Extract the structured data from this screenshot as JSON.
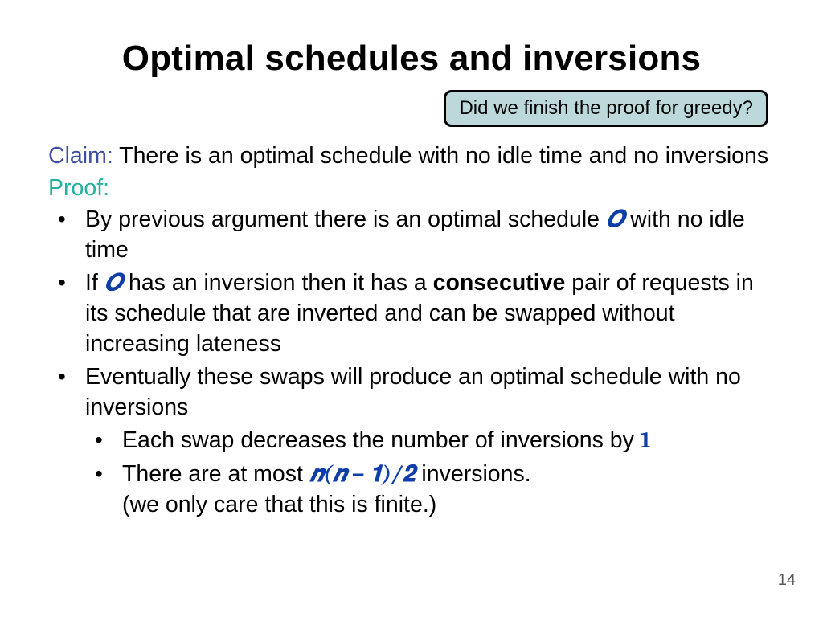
{
  "title": "Optimal schedules and inversions",
  "callout": "Did we finish the proof for greedy?",
  "claim": {
    "label": "Claim:",
    "text": " There is an optimal schedule with no idle time and no inversions"
  },
  "proof": {
    "label": "Proof:"
  },
  "symbols": {
    "O1": "𝑶",
    "O2": "𝑶",
    "one": "1",
    "formula": "𝒏(𝒏 − 𝟏)/𝟐"
  },
  "bullets": {
    "b1a": "By previous argument there is an optimal schedule ",
    "b1b": " with no idle time",
    "b2a": "If ",
    "b2b": " has an inversion then it has a ",
    "b2bold": "consecutive",
    "b2c": " pair of requests in its schedule that are inverted and can be swapped without increasing lateness",
    "b3": "Eventually these swaps will produce an optimal schedule with no inversions",
    "sub1a": "Each swap decreases the number of inversions by ",
    "sub2a": "There are at most  ",
    "sub2b": " inversions.",
    "sub2c": "(we only care that this is finite.)"
  },
  "slide_number": "14"
}
